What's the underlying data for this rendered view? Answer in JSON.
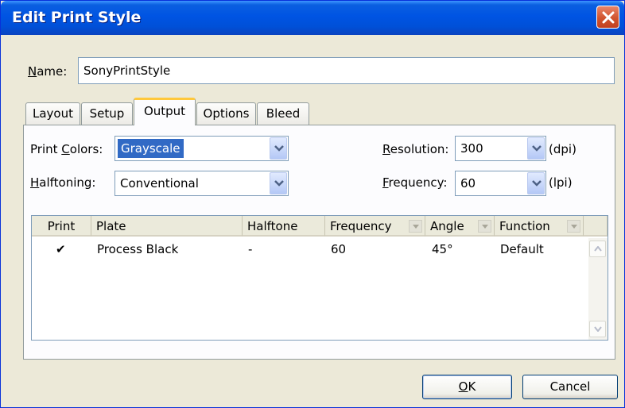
{
  "window": {
    "title": "Edit Print Style"
  },
  "name_field": {
    "label_underlined": "N",
    "label_rest": "ame:",
    "value": "SonyPrintStyle"
  },
  "tabs": [
    {
      "label": "Layout",
      "active": false
    },
    {
      "label": "Setup",
      "active": false
    },
    {
      "label": "Output",
      "active": true
    },
    {
      "label": "Options",
      "active": false
    },
    {
      "label": "Bleed",
      "active": false
    }
  ],
  "output": {
    "print_colors": {
      "label_pre": "Print ",
      "label_underlined": "C",
      "label_post": "olors:",
      "value": "Grayscale"
    },
    "halftoning": {
      "label_underlined": "H",
      "label_rest": "alftoning:",
      "value": "Conventional"
    },
    "resolution": {
      "label_underlined": "R",
      "label_rest": "esolution:",
      "value": "300",
      "unit": "(dpi)"
    },
    "frequency": {
      "label_underlined": "F",
      "label_rest": "requency:",
      "value": "60",
      "unit": "(lpi)"
    }
  },
  "plates_table": {
    "columns": [
      "Print",
      "Plate",
      "Halftone",
      "Frequency",
      "Angle",
      "Function"
    ],
    "rows": [
      {
        "print": "✔",
        "plate": "Process Black",
        "halftone": "-",
        "frequency": "60",
        "angle": "45°",
        "function": "Default"
      }
    ]
  },
  "buttons": {
    "ok_underlined": "O",
    "ok_rest": "K",
    "cancel": "Cancel"
  },
  "icons": {
    "close": "close-icon",
    "dropdown": "chevron-down-icon",
    "scroll_up": "scroll-up-arrow-icon",
    "scroll_down": "scroll-down-arrow-icon"
  },
  "colors": {
    "title_bar": "#0054e3",
    "dialog_bg": "#ece9d8",
    "selection": "#316ac5",
    "close_button": "#d1542e",
    "active_tab_accent": "#ffc83c"
  }
}
